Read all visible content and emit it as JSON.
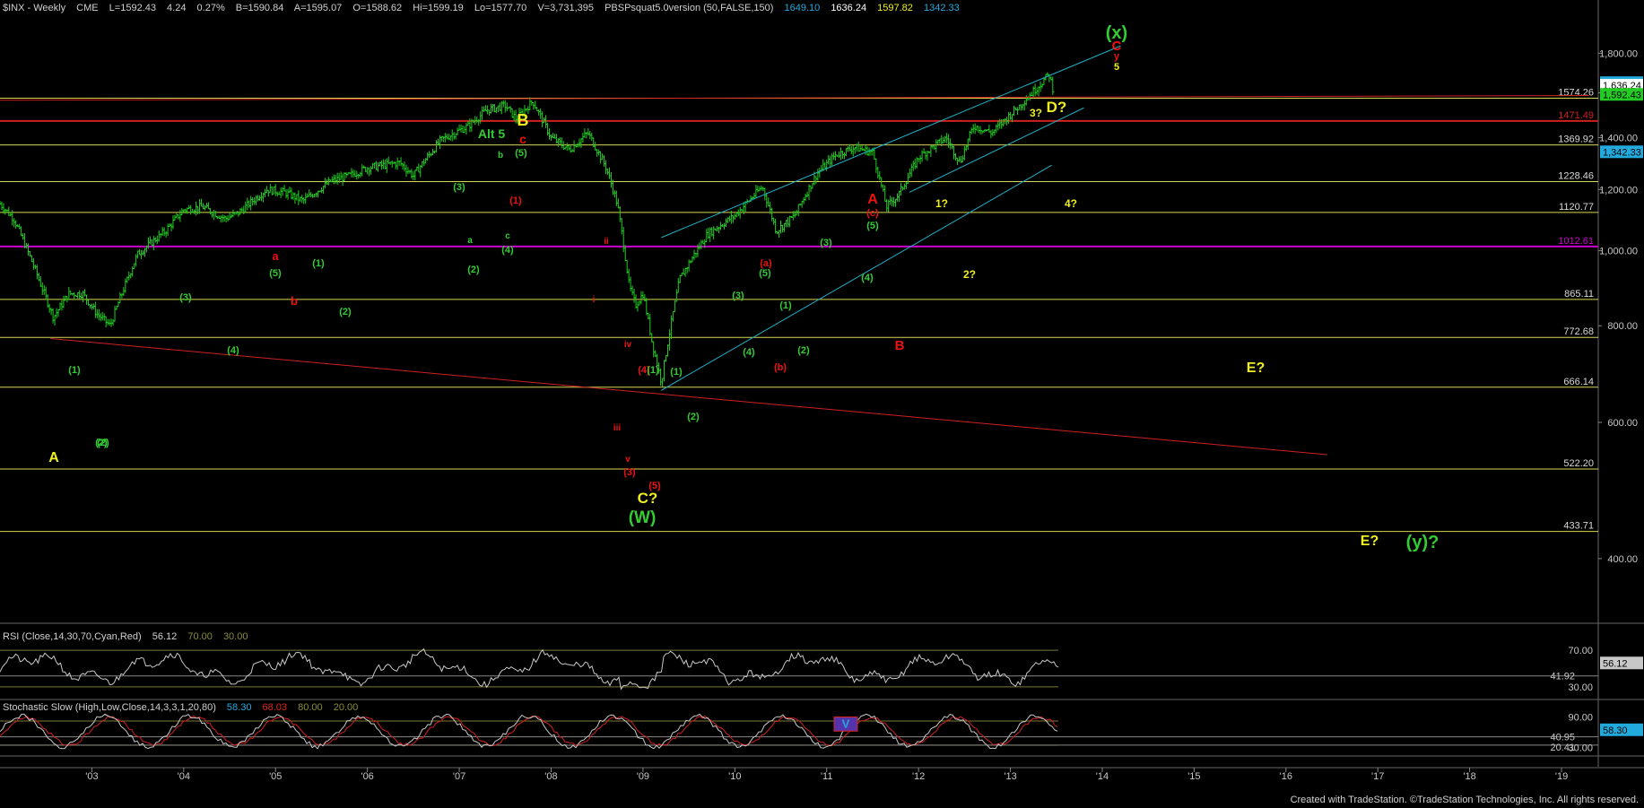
{
  "header": {
    "symbol": "$INX - Weekly",
    "exchange": "CME",
    "last": "L=1592.43",
    "change": "4.24",
    "pct": "0.27%",
    "bid": "B=1590.84",
    "ask": "A=1595.07",
    "open": "O=1588.62",
    "high": "Hi=1599.19",
    "low": "Lo=1577.70",
    "volume": "V=3,731,395",
    "indicator": "PBSPsquat5.0version (50,FALSE,150)",
    "ind_values": [
      "1649.10",
      "1636.24",
      "1597.82",
      "1342.33"
    ]
  },
  "rsi": {
    "title": "RSI (Close,14,30,70,Cyan,Red)",
    "values": [
      "56.12",
      "70.00",
      "30.00"
    ],
    "axis_labels": [
      "70.00",
      "30.00"
    ],
    "level_label": "41.92",
    "current_label": "56.12"
  },
  "stoch": {
    "title": "Stochastic Slow (High,Low,Close,14,3,3,1,20,80)",
    "values": [
      "58.30",
      "68.03",
      "80.00",
      "20.00"
    ],
    "axis_labels": [
      "90.00",
      "30.00"
    ],
    "level_label_1": "40.95",
    "level_label_2": "20.41",
    "current_label": "58.30",
    "marker": "V"
  },
  "footer": "Created with TradeStation. ©TradeStation Technologies, Inc. All rights reserved.",
  "colors": {
    "background": "#000000",
    "price_bars": "#22cc22",
    "yellow_levels": "#d8d850",
    "red_level": "#d02020",
    "magenta_level": "#cc00cc",
    "channel": "#20b0c8",
    "label_green": "#33cc33",
    "label_red": "#ee1111",
    "label_yellow": "#eeee22",
    "rsi_line": "#c8c8c8",
    "stoch_k": "#c8c8c8",
    "stoch_d": "#d02020"
  },
  "chart_data": {
    "type": "line",
    "title": "$INX - Weekly",
    "xlabel": "",
    "ylabel": "",
    "x_ticks": [
      "'03",
      "'04",
      "'05",
      "'06",
      "'07",
      "'08",
      "'09",
      "'10",
      "'11",
      "'12",
      "'13",
      "'14",
      "'15",
      "'16",
      "'17",
      "'18",
      "'19"
    ],
    "y_ticks": [
      "400.00",
      "600.00",
      "800.00",
      "1,000.00",
      "1,200.00",
      "1,400.00",
      "1,600.00",
      "1,800.00"
    ],
    "ylim": [
      330,
      2010
    ],
    "xlim": [
      2002.0,
      2019.4
    ],
    "horizontal_levels": [
      {
        "label": "1574.26",
        "value": 1574.26,
        "color": "yellow"
      },
      {
        "label": "1471.49",
        "value": 1471.49,
        "color": "red"
      },
      {
        "label": "1369.92",
        "value": 1369.92,
        "color": "yellow"
      },
      {
        "label": "1228.46",
        "value": 1228.46,
        "color": "yellow"
      },
      {
        "label": "1120.77",
        "value": 1120.77,
        "color": "yellow"
      },
      {
        "label": "1012.61",
        "value": 1012.61,
        "color": "magenta"
      },
      {
        "label": "865.11",
        "value": 865.11,
        "color": "yellow"
      },
      {
        "label": "772.68",
        "value": 772.68,
        "color": "yellow"
      },
      {
        "label": "666.14",
        "value": 666.14,
        "color": "yellow"
      },
      {
        "label": "522.20",
        "value": 522.2,
        "color": "yellow"
      },
      {
        "label": "433.71",
        "value": 433.71,
        "color": "yellow"
      }
    ],
    "right_price_tags": [
      {
        "label": "1,649.10",
        "value": 1649.1,
        "bg": "#22aadd"
      },
      {
        "label": "1,636.24",
        "value": 1636.24,
        "bg": "#ffffff"
      },
      {
        "label": "1,592.43",
        "value": 1592.43,
        "bg": "#22cc22"
      },
      {
        "label": "1,342.33",
        "value": 1342.33,
        "bg": "#22aadd"
      }
    ],
    "series": [
      {
        "name": "",
        "x": [
          2002.0,
          2002.15,
          2002.3,
          2002.45,
          2002.58,
          2002.75,
          2002.9,
          2003.05,
          2003.2,
          2003.5,
          2003.8,
          2004.0,
          2004.2,
          2004.45,
          2004.6,
          2004.9,
          2005.1,
          2005.3,
          2005.6,
          2005.8,
          2006.0,
          2006.35,
          2006.5,
          2006.8,
          2007.1,
          2007.3,
          2007.5,
          2007.62,
          2007.8,
          2008.0,
          2008.2,
          2008.4,
          2008.6,
          2008.72,
          2008.85,
          2008.92,
          2009.0,
          2009.1,
          2009.2,
          2009.4,
          2009.7,
          2010.0,
          2010.3,
          2010.45,
          2010.65,
          2010.9,
          2011.1,
          2011.3,
          2011.5,
          2011.65,
          2011.78,
          2012.0,
          2012.3,
          2012.45,
          2012.6,
          2012.8,
          2012.9,
          2013.1,
          2013.3,
          2013.42,
          2013.48
        ],
        "y": [
          1150,
          1100,
          1000,
          900,
          820,
          880,
          880,
          830,
          800,
          990,
          1060,
          1130,
          1140,
          1100,
          1120,
          1200,
          1190,
          1160,
          1230,
          1250,
          1280,
          1300,
          1250,
          1390,
          1450,
          1520,
          1540,
          1480,
          1560,
          1400,
          1350,
          1420,
          1280,
          1150,
          900,
          850,
          880,
          760,
          676,
          920,
          1050,
          1110,
          1210,
          1060,
          1110,
          1260,
          1330,
          1360,
          1340,
          1140,
          1180,
          1320,
          1400,
          1300,
          1450,
          1420,
          1460,
          1540,
          1630,
          1690,
          1592
        ]
      }
    ],
    "wave_labels": [
      "(x)",
      "C",
      "y",
      "5",
      "D?",
      "3?",
      "Alt 5",
      "B",
      "c",
      "b",
      "(5)",
      "(3)",
      "a",
      "c",
      "(4)",
      "(2)",
      "(1)",
      "ii",
      "i",
      "iv",
      "(4)",
      "(1)",
      "iii",
      "v",
      "(3)",
      "(5)",
      "C?",
      "(W)",
      "A",
      "(c)",
      "(5)",
      "(3)",
      "(4)",
      "B",
      "1?",
      "2?",
      "4?",
      "(a)",
      "(5)",
      "(3)",
      "(1)",
      "(2)",
      "(4)",
      "(b)",
      "(1)",
      "(2)",
      "a",
      "(5)",
      "b",
      "(3)",
      "(1)",
      "(2)",
      "(4)",
      "(1)",
      "(2)",
      "A",
      "(2)",
      "E?",
      "E?",
      "(y)?"
    ]
  }
}
